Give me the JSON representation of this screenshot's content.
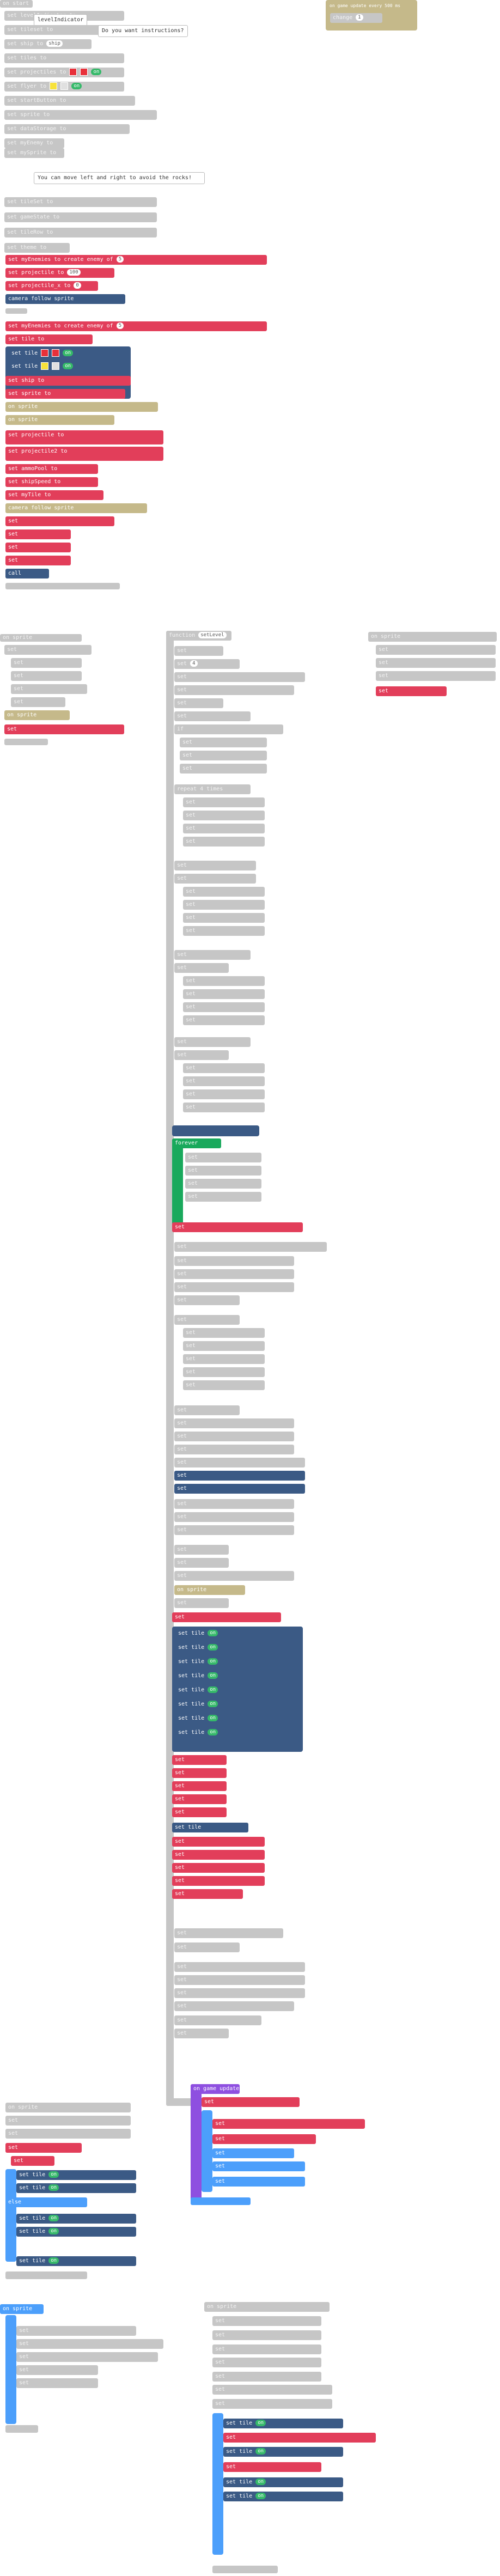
{
  "palette": {
    "event": "#c5b98a",
    "variable": "#e23e5a",
    "sprite": "#4c9ffb",
    "tile": "#3b5a85",
    "loop": "#19a95c",
    "disabled": "#c6c6c6",
    "function": "#8e4fe0"
  },
  "top_left_column": {
    "header": "on start",
    "blocks": [
      "set levelIndicator to",
      "set tileset to",
      "set ship to",
      "set tiles to",
      "set projectiles to",
      "set flyer to",
      "set startButton to",
      "set sprite to",
      "set dataStorage to",
      "set myEnemy to",
      "set mySprite to",
      "set tileSet to",
      "set gameState to",
      "set tileRow to",
      "set theme to",
      "set projectile to",
      "set projectile2 to",
      "set projectile_level to",
      "set ammoCount to",
      "set projectile_attackers to",
      "set ammoPool to",
      "set shipSpeed to",
      "set spriteX to",
      "set myTile to"
    ],
    "notes": [
      "levelIndicator",
      "Do you want instructions?",
      "You can move left and right to avoid the rocks!"
    ]
  },
  "highlighted_blocks": [
    "set myEnemies to create enemy of",
    "set projectile to",
    "set projectile_x to",
    "camera follow sprite",
    "set tile to",
    "set ship to",
    "set sprite to",
    "set spriteSpeed to",
    "set projectile to",
    "set projectile2 to",
    "set ammoPool to",
    "set shipSpeed to",
    "set myTile to"
  ],
  "event_top_right": "on game update every 500 ms",
  "event_label_2": "on game update",
  "main_function": {
    "header": "function",
    "name": "setLevel",
    "value_pill": "4"
  },
  "repeat_block": "repeat 4 times",
  "loop_block": "forever",
  "misc_values": [
    "0",
    "1",
    "2",
    "3",
    "4",
    "5",
    "10",
    "100",
    "200"
  ]
}
